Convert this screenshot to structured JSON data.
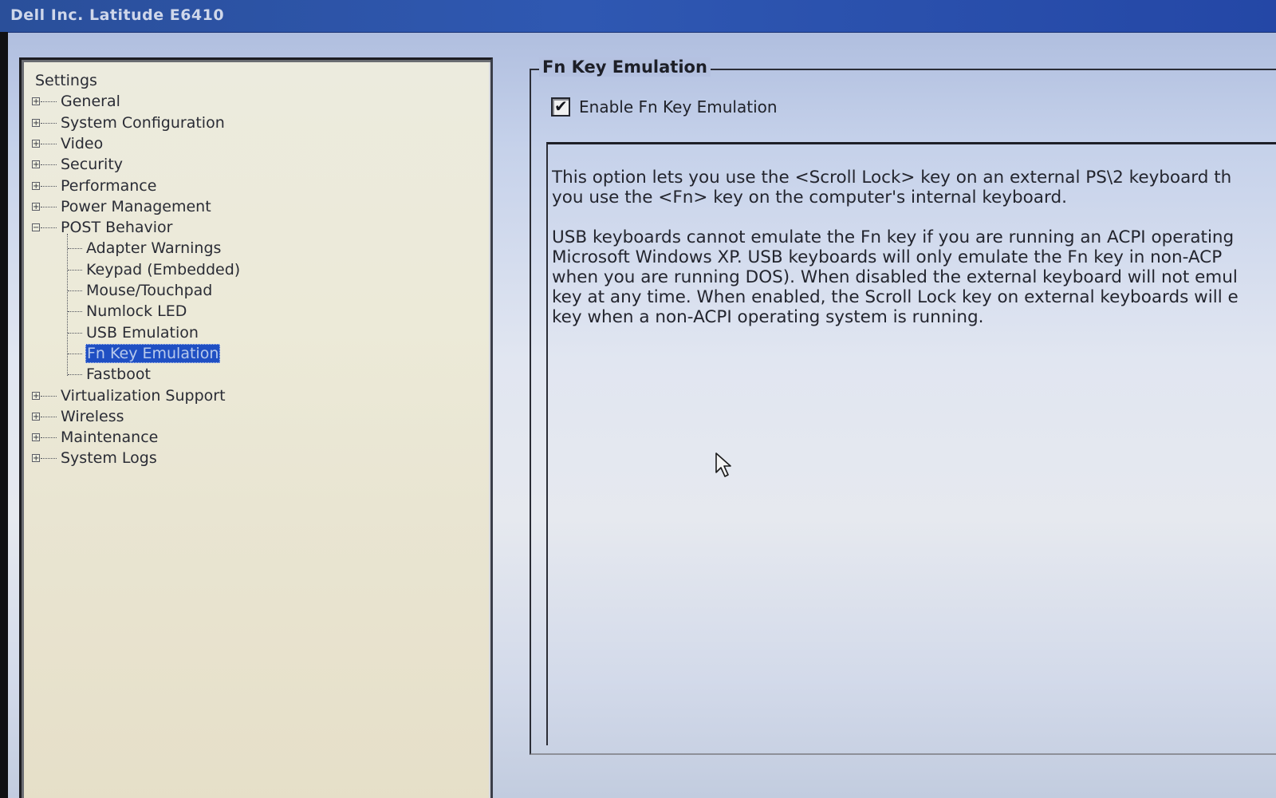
{
  "window": {
    "title": "Dell Inc. Latitude E6410"
  },
  "tree": {
    "root_label": "Settings",
    "items": [
      {
        "label": "General",
        "expander": "+"
      },
      {
        "label": "System Configuration",
        "expander": "+"
      },
      {
        "label": "Video",
        "expander": "+"
      },
      {
        "label": "Security",
        "expander": "+"
      },
      {
        "label": "Performance",
        "expander": "+"
      },
      {
        "label": "Power Management",
        "expander": "+"
      },
      {
        "label": "POST Behavior",
        "expander": "−",
        "children": [
          {
            "label": "Adapter Warnings"
          },
          {
            "label": "Keypad (Embedded)"
          },
          {
            "label": "Mouse/Touchpad"
          },
          {
            "label": "Numlock LED"
          },
          {
            "label": "USB Emulation"
          },
          {
            "label": "Fn Key Emulation",
            "selected": true
          },
          {
            "label": "Fastboot"
          }
        ]
      },
      {
        "label": "Virtualization Support",
        "expander": "+"
      },
      {
        "label": "Wireless",
        "expander": "+"
      },
      {
        "label": "Maintenance",
        "expander": "+"
      },
      {
        "label": "System Logs",
        "expander": "+"
      }
    ]
  },
  "content": {
    "group_title": "Fn Key Emulation",
    "checkbox": {
      "label": "Enable Fn Key Emulation",
      "checked": true
    },
    "help_text_lines": [
      "This option lets you use the <Scroll Lock> key on an external PS\\2 keyboard th",
      "you use the <Fn> key on the computer's internal keyboard.",
      "",
      "USB keyboards cannot emulate the Fn key if you are running an ACPI operating",
      "Microsoft Windows XP. USB keyboards will only emulate the Fn key in non-ACP",
      "when you are running DOS). When disabled the external keyboard will not emul",
      "key at any time. When enabled, the Scroll Lock key on external keyboards will e",
      "key when a non-ACPI operating system is running."
    ]
  },
  "icons": {
    "expand": "plus-box-icon",
    "collapse": "minus-box-icon",
    "checkmark": "checkmark-icon",
    "pointer": "mouse-pointer-icon"
  },
  "colors": {
    "titlebar": "#2f58b2",
    "selection": "#1f4fc3",
    "tree_background": "#ecebde"
  }
}
